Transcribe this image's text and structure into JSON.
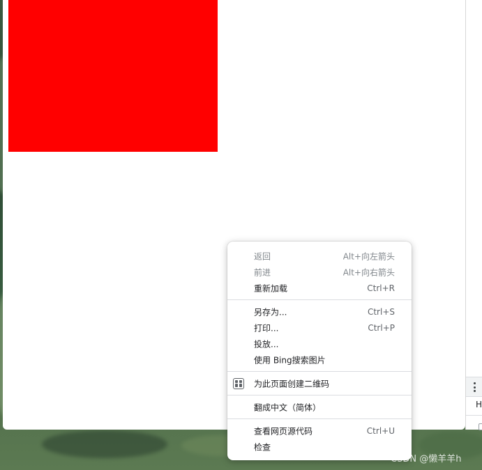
{
  "colors": {
    "page_background": "#ffffff",
    "red_box": "#ff0000",
    "menu_text": "#202124",
    "menu_disabled_text": "#80868b"
  },
  "devtools": {
    "menu_icon": "kebab-icon",
    "tab_label": "H"
  },
  "context_menu": {
    "groups": [
      [
        {
          "label": "返回",
          "shortcut": "Alt+向左箭头",
          "disabled": true
        },
        {
          "label": "前进",
          "shortcut": "Alt+向右箭头",
          "disabled": true
        },
        {
          "label": "重新加载",
          "shortcut": "Ctrl+R",
          "disabled": false
        }
      ],
      [
        {
          "label": "另存为...",
          "shortcut": "Ctrl+S",
          "disabled": false
        },
        {
          "label": "打印...",
          "shortcut": "Ctrl+P",
          "disabled": false
        },
        {
          "label": "投放...",
          "shortcut": "",
          "disabled": false
        },
        {
          "label": "使用 Bing搜索图片",
          "shortcut": "",
          "disabled": false
        }
      ],
      [
        {
          "label": "为此页面创建二维码",
          "shortcut": "",
          "disabled": false,
          "icon": "qr-code-icon"
        }
      ],
      [
        {
          "label": "翻成中文（简体）",
          "shortcut": "",
          "disabled": false
        }
      ],
      [
        {
          "label": "查看网页源代码",
          "shortcut": "Ctrl+U",
          "disabled": false
        },
        {
          "label": "检查",
          "shortcut": "",
          "disabled": false
        }
      ]
    ]
  },
  "watermark": "CSDN @懒羊羊h"
}
